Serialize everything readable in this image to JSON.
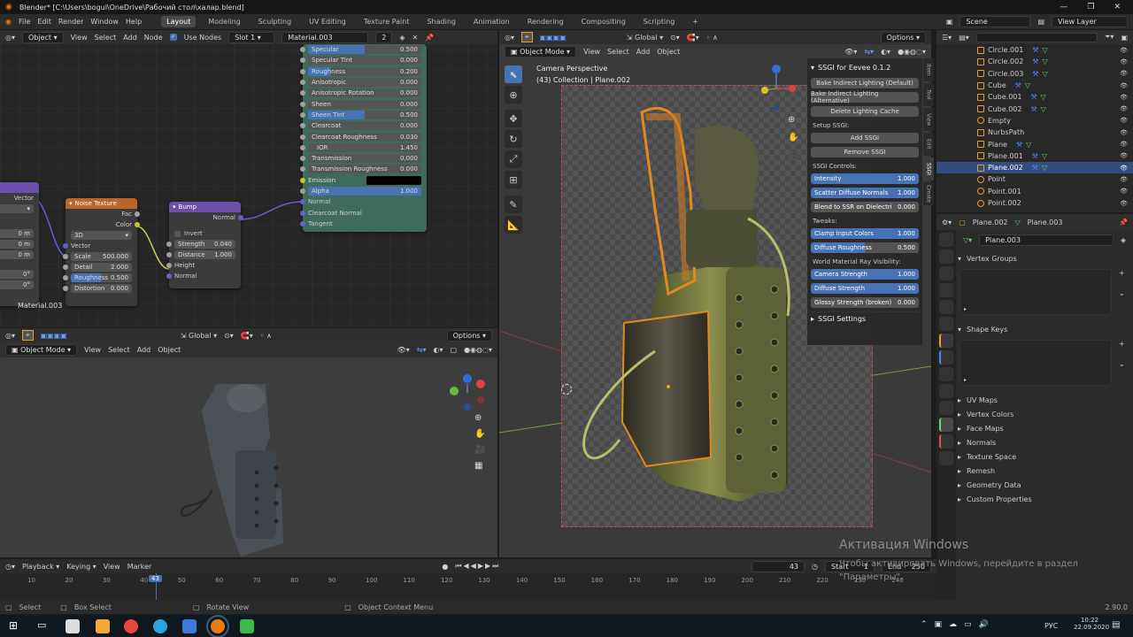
{
  "window": {
    "title": "Blender* [C:\\Users\\bogul\\OneDrive\\Рабочий стол\\халар.blend]",
    "minimize": "—",
    "maximize": "❐",
    "close": "✕"
  },
  "menu": {
    "items": [
      "File",
      "Edit",
      "Render",
      "Window",
      "Help"
    ],
    "workspaces": [
      "Layout",
      "Modeling",
      "Sculpting",
      "UV Editing",
      "Texture Paint",
      "Shading",
      "Animation",
      "Rendering",
      "Compositing",
      "Scripting"
    ],
    "active_workspace": "Layout",
    "scene": "Scene",
    "view_layer": "View Layer"
  },
  "node_editor": {
    "mode": "Object",
    "menus": [
      "View",
      "Select",
      "Add",
      "Node"
    ],
    "use_nodes": "Use Nodes",
    "slot": "Slot 1",
    "material": "Material.003",
    "users": "2",
    "label": "Material.003",
    "left_node": {
      "vector": "Vector",
      "vals": [
        "0 m",
        "0 m",
        "0 m",
        "0°",
        "0°"
      ]
    },
    "noise": {
      "title": "Noise Texture",
      "fac": "Fac",
      "color": "Color",
      "dim": "3D",
      "vector": "Vector",
      "scale_label": "Scale",
      "scale": "500.000",
      "detail_label": "Detail",
      "detail": "2.000",
      "rough_label": "Roughness",
      "rough": "0.500",
      "dist_label": "Distortion",
      "dist": "0.000"
    },
    "bump": {
      "title": "Bump",
      "normal_out": "Normal",
      "invert": "Invert",
      "strength_label": "Strength",
      "strength": "0.040",
      "distance_label": "Distance",
      "distance": "1.000",
      "height": "Height",
      "normal": "Normal"
    },
    "bsdf": {
      "rows": [
        {
          "l": "Specular",
          "v": "0.500",
          "p": "0.5"
        },
        {
          "l": "Specular Tint",
          "v": "0.000",
          "p": "0"
        },
        {
          "l": "Roughness",
          "v": "0.200",
          "p": "0.2"
        },
        {
          "l": "Anisotropic",
          "v": "0.000",
          "p": "0"
        },
        {
          "l": "Anisotropic Rotation",
          "v": "0.000",
          "p": "0"
        },
        {
          "l": "Sheen",
          "v": "0.000",
          "p": "0"
        },
        {
          "l": "Sheen Tint",
          "v": "0.500",
          "p": "0.5"
        },
        {
          "l": "Clearcoat",
          "v": "0.000",
          "p": "0"
        },
        {
          "l": "Clearcoat Roughness",
          "v": "0.030",
          "p": "0"
        },
        {
          "l": "IOR",
          "v": "1.450",
          "p": "0"
        },
        {
          "l": "Transmission",
          "v": "0.000",
          "p": "0"
        },
        {
          "l": "Transmission Roughness",
          "v": "0.000",
          "p": "0"
        }
      ],
      "emission": "Emission",
      "alpha": "Alpha",
      "alpha_v": "1.000",
      "normal": "Normal",
      "clearcoat_normal": "Clearcoat Normal",
      "tangent": "Tangent"
    }
  },
  "left_viewport": {
    "transform": "Global",
    "options": "Options",
    "mode": "Object Mode",
    "menus": [
      "View",
      "Select",
      "Add",
      "Object"
    ]
  },
  "main_viewport": {
    "mode": "Object Mode",
    "menus": [
      "View",
      "Select",
      "Add",
      "Object"
    ],
    "transform": "Global",
    "options": "Options",
    "camera": "Camera Perspective",
    "collection": "(43) Collection | Plane.002"
  },
  "ssgi": {
    "title": "SSGI for Eevee 0.1.2",
    "bake_default": "Bake Indirect Lighting (Default)",
    "bake_alt": "Bake Indirect Lighting (Alternative)",
    "delete_cache": "Delete Lighting Cache",
    "setup_label": "Setup SSGI:",
    "add": "Add SSGI",
    "remove": "Remove SSGI",
    "controls_label": "SSGI Controls:",
    "controls": [
      {
        "l": "Intensity",
        "v": "1.000",
        "p": "1"
      },
      {
        "l": "Scatter Diffuse Normals",
        "v": "1.000",
        "p": "1"
      },
      {
        "l": "Blend to SSR on Dielectri",
        "v": "0.000",
        "p": "0"
      }
    ],
    "tweaks_label": "Tweaks:",
    "tweaks": [
      {
        "l": "Clamp Input Colors",
        "v": "1.000",
        "p": "1"
      },
      {
        "l": "Diffuse Roughness",
        "v": "0.500",
        "p": "0.5"
      }
    ],
    "world_label": "World Material Ray Visibility:",
    "world": [
      {
        "l": "Camera Strength",
        "v": "1.000",
        "p": "1"
      },
      {
        "l": "Diffuse Strength",
        "v": "1.000",
        "p": "1"
      },
      {
        "l": "Glossy Strength (broken)",
        "v": "0.000",
        "p": "0"
      }
    ],
    "settings": "SSGI Settings",
    "tabs": [
      "Item",
      "Tool",
      "View",
      "Edit",
      "SSGI",
      "Create"
    ],
    "active_tab": "SSGI"
  },
  "outliner": {
    "items": [
      {
        "name": "Circle.001",
        "sel": false
      },
      {
        "name": "Circle.002",
        "sel": false
      },
      {
        "name": "Circle.003",
        "sel": false
      },
      {
        "name": "Cube",
        "sel": false
      },
      {
        "name": "Cube.001",
        "sel": false
      },
      {
        "name": "Cube.002",
        "sel": false
      },
      {
        "name": "Empty",
        "sel": false
      },
      {
        "name": "NurbsPath",
        "sel": false
      },
      {
        "name": "Plane",
        "sel": false
      },
      {
        "name": "Plane.001",
        "sel": false
      },
      {
        "name": "Plane.002",
        "sel": true
      },
      {
        "name": "Point",
        "sel": false
      },
      {
        "name": "Point.001",
        "sel": false
      },
      {
        "name": "Point.002",
        "sel": false
      }
    ]
  },
  "properties": {
    "object": "Plane.002",
    "mesh": "Plane.003",
    "mesh_field": "Plane.003",
    "vertex_groups": "Vertex Groups",
    "shape_keys": "Shape Keys",
    "sections": [
      "UV Maps",
      "Vertex Colors",
      "Face Maps",
      "Normals",
      "Texture Space",
      "Remesh",
      "Geometry Data",
      "Custom Properties"
    ]
  },
  "timeline": {
    "menus": [
      "Playback",
      "Keying",
      "View",
      "Marker"
    ],
    "current": "43",
    "start_label": "Start",
    "start": "1",
    "end_label": "End",
    "end": "250",
    "ticks": [
      "10",
      "20",
      "30",
      "40",
      "50",
      "60",
      "70",
      "80",
      "90",
      "100",
      "110",
      "120",
      "130",
      "140",
      "150",
      "160",
      "170",
      "180",
      "190",
      "200",
      "210",
      "220",
      "230",
      "240"
    ]
  },
  "status": {
    "select": "Select",
    "box_select": "Box Select",
    "rotate_view": "Rotate View",
    "context_menu": "Object Context Menu",
    "version": "2.90.0"
  },
  "activation": {
    "title": "Активация Windows",
    "text": "Чтобы активировать Windows, перейдите в раздел \"Параметры\"."
  },
  "taskbar": {
    "lang": "РУС",
    "time": "10:22",
    "date": "22.09.2020"
  }
}
